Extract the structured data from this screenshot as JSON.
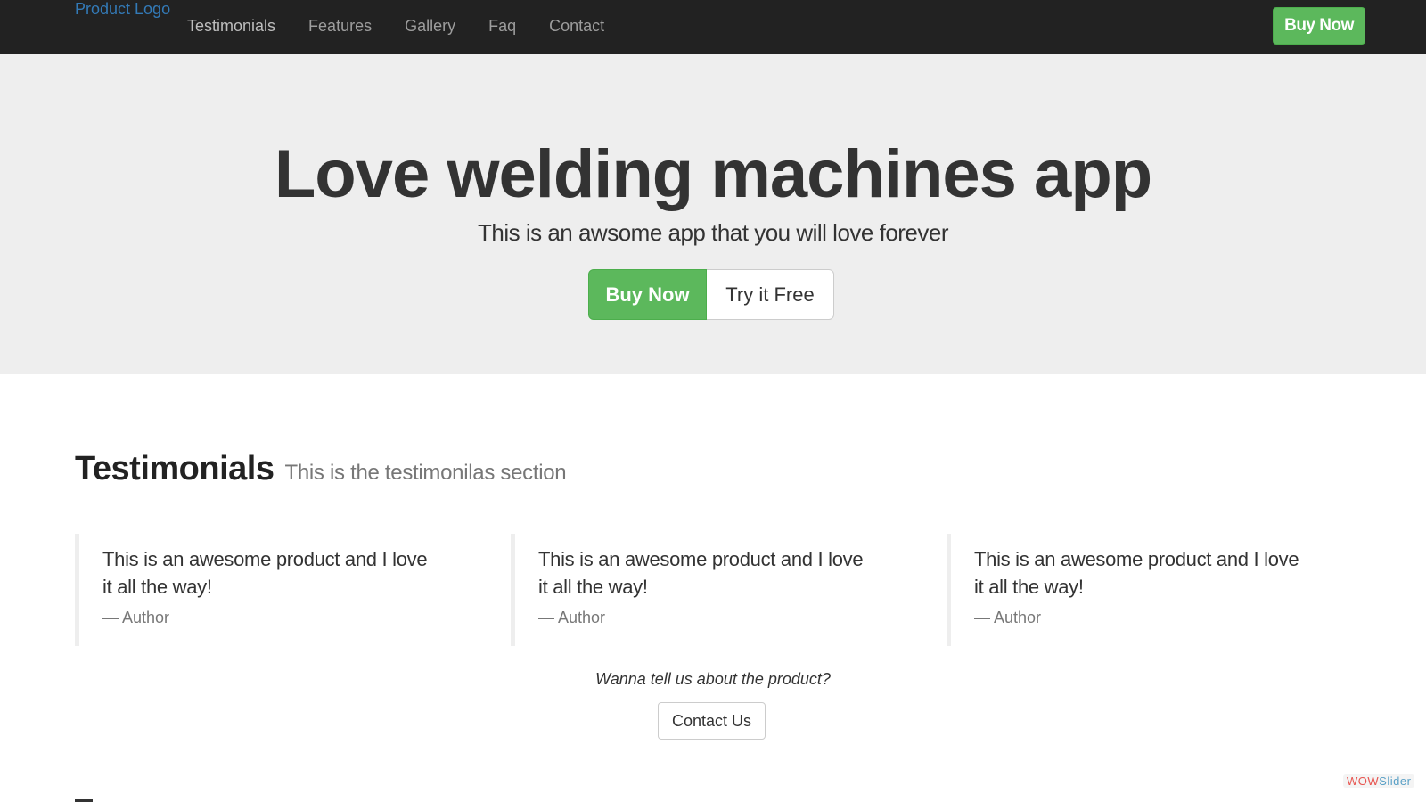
{
  "nav": {
    "brand": "Product Logo",
    "links": [
      "Testimonials",
      "Features",
      "Gallery",
      "Faq",
      "Contact"
    ],
    "buy_label": "Buy Now"
  },
  "hero": {
    "title": "Love welding machines app",
    "subtitle": "This is an awsome app that you will love forever",
    "buy_label": "Buy Now",
    "try_label": "Try it Free"
  },
  "testimonials": {
    "title": "Testimonials",
    "subtitle": "This is the testimonilas section",
    "items": [
      {
        "text": "This is an awesome product and I love it all the way!",
        "author": "— Author"
      },
      {
        "text": "This is an awesome product and I love it all the way!",
        "author": "— Author"
      },
      {
        "text": "This is an awesome product and I love it all the way!",
        "author": "— Author"
      }
    ],
    "cta_text": "Wanna tell us about the product?",
    "cta_button": "Contact Us"
  },
  "watermark": {
    "part1": "WOW",
    "part2": "Slider"
  },
  "colors": {
    "navbar": "#222222",
    "brand": "#337ab7",
    "success": "#5cb85c",
    "hero_bg": "#eeeeee"
  }
}
